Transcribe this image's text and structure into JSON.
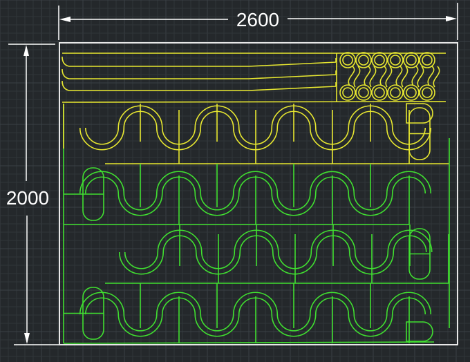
{
  "drawing": {
    "width_dimension_label": "2600",
    "height_dimension_label": "2000"
  },
  "colors": {
    "background": "#24282b",
    "grid_minor": "#30363a",
    "grid_major": "#3a4146",
    "dimension": "#ffffff",
    "frame": "#e8e8e8",
    "layer_yellow": "#e8e830",
    "layer_green": "#40e030"
  }
}
